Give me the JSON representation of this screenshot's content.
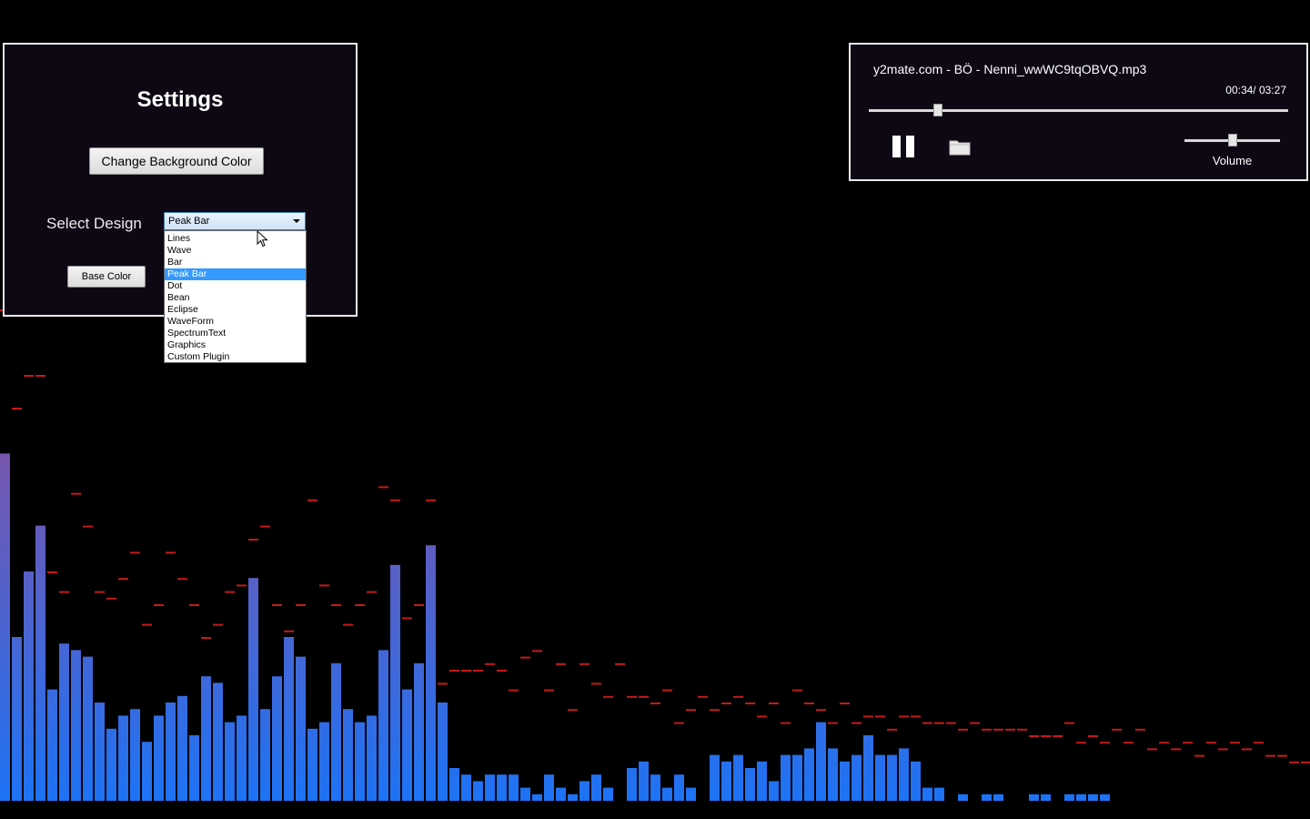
{
  "settings": {
    "title": "Settings",
    "change_bg_label": "Change Background Color",
    "select_design_label": "Select Design",
    "selected_design": "Peak Bar",
    "design_options": [
      "Lines",
      "Wave",
      "Bar",
      "Peak Bar",
      "Dot",
      "Bean",
      "Eclipse",
      "WaveForm",
      "SpectrumText",
      "Graphics",
      "Custom Plugin"
    ],
    "base_color_label": "Base Color"
  },
  "player": {
    "track_title": "y2mate.com - BÖ - Nenni_wwWC9tqOBVQ.mp3",
    "time_display": "00:34/ 03:27",
    "progress_fraction": 0.164,
    "volume_fraction": 0.5,
    "volume_label": "Volume",
    "pause_icon": "pause-icon",
    "folder_icon": "folder-icon"
  },
  "visualizer": {
    "design": "Peak Bar",
    "bar_color_bottom": "#1d73f5",
    "bar_color_top": "#c63c6e",
    "peak_color": "#c41a1a",
    "background": "#000000",
    "levels": [
      0.53,
      0.25,
      0.35,
      0.42,
      0.17,
      0.24,
      0.23,
      0.22,
      0.15,
      0.11,
      0.13,
      0.14,
      0.09,
      0.13,
      0.15,
      0.16,
      0.1,
      0.19,
      0.18,
      0.12,
      0.13,
      0.34,
      0.14,
      0.19,
      0.25,
      0.22,
      0.11,
      0.12,
      0.21,
      0.14,
      0.12,
      0.13,
      0.23,
      0.36,
      0.17,
      0.21,
      0.39,
      0.15,
      0.05,
      0.04,
      0.03,
      0.04,
      0.04,
      0.04,
      0.02,
      0.01,
      0.04,
      0.02,
      0.01,
      0.03,
      0.04,
      0.02,
      0.0,
      0.05,
      0.06,
      0.04,
      0.02,
      0.04,
      0.02,
      0.0,
      0.07,
      0.06,
      0.07,
      0.05,
      0.06,
      0.03,
      0.07,
      0.07,
      0.08,
      0.12,
      0.08,
      0.06,
      0.07,
      0.1,
      0.07,
      0.07,
      0.08,
      0.06,
      0.02,
      0.02,
      0.0,
      0.01,
      0.0,
      0.01,
      0.01,
      0.0,
      0.0,
      0.01,
      0.01,
      0.0,
      0.01,
      0.01,
      0.01,
      0.01,
      0.0,
      0.0,
      0.0,
      0.0,
      0.0,
      0.0,
      0.0,
      0.0,
      0.0,
      0.0,
      0.0,
      0.0,
      0.0,
      0.0,
      0.0,
      0.0,
      0.0
    ],
    "peaks": [
      0.75,
      0.6,
      0.65,
      0.65,
      0.35,
      0.32,
      0.47,
      0.42,
      0.32,
      0.31,
      0.34,
      0.38,
      0.27,
      0.3,
      0.38,
      0.34,
      0.3,
      0.25,
      0.27,
      0.32,
      0.33,
      0.4,
      0.42,
      0.3,
      0.26,
      0.3,
      0.46,
      0.33,
      0.3,
      0.27,
      0.3,
      0.32,
      0.48,
      0.46,
      0.28,
      0.3,
      0.46,
      0.18,
      0.2,
      0.2,
      0.2,
      0.21,
      0.2,
      0.17,
      0.22,
      0.23,
      0.17,
      0.21,
      0.14,
      0.21,
      0.18,
      0.16,
      0.21,
      0.16,
      0.16,
      0.15,
      0.17,
      0.12,
      0.14,
      0.16,
      0.14,
      0.15,
      0.16,
      0.15,
      0.13,
      0.15,
      0.12,
      0.17,
      0.15,
      0.14,
      0.12,
      0.15,
      0.12,
      0.13,
      0.13,
      0.11,
      0.13,
      0.13,
      0.12,
      0.12,
      0.12,
      0.11,
      0.12,
      0.11,
      0.11,
      0.11,
      0.11,
      0.1,
      0.1,
      0.1,
      0.12,
      0.09,
      0.1,
      0.09,
      0.11,
      0.09,
      0.11,
      0.08,
      0.09,
      0.08,
      0.09,
      0.07,
      0.09,
      0.08,
      0.09,
      0.08,
      0.09,
      0.07,
      0.07,
      0.06,
      0.06
    ]
  }
}
